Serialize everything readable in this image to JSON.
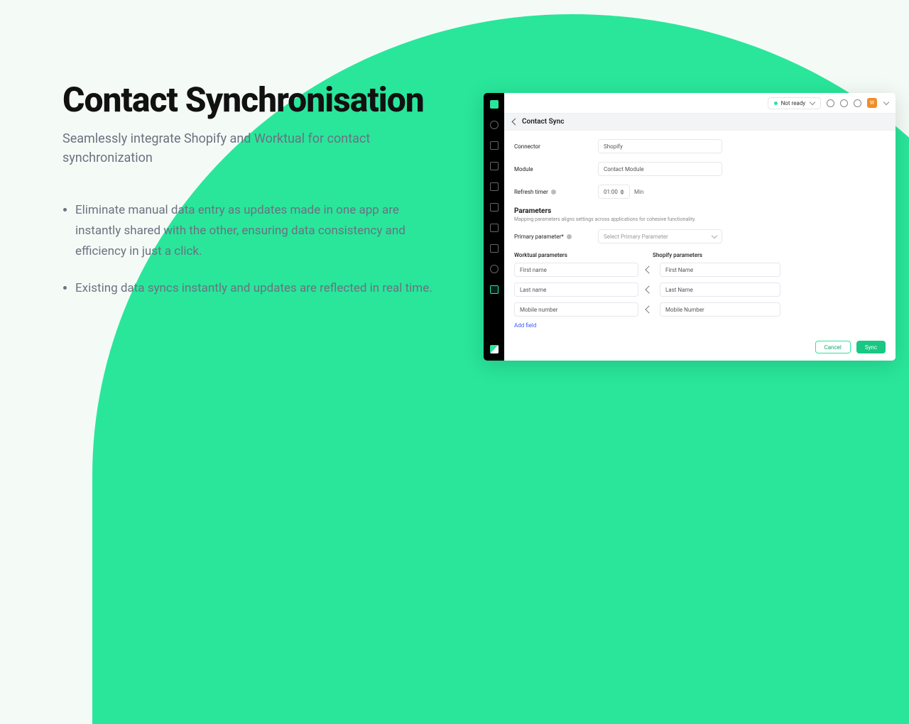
{
  "marketing": {
    "title": "Contact Synchronisation",
    "subtitle": "Seamlessly integrate Shopify and Worktual for contact synchronization",
    "bullets": [
      "Eliminate manual data entry as updates made in one app are instantly shared with the other, ensuring data consistency and efficiency in just a click.",
      "Existing data syncs instantly and updates are reflected in real time."
    ]
  },
  "topbar": {
    "status": "Not ready",
    "avatar": "W"
  },
  "crumb": {
    "title": "Contact Sync"
  },
  "form": {
    "connector_label": "Connector",
    "connector_value": "Shopify",
    "module_label": "Module",
    "module_value": "Contact Module",
    "refresh_label": "Refresh timer",
    "refresh_value": "01:00",
    "refresh_unit": "Min",
    "params_title": "Parameters",
    "params_sub": "Mapping parameters aligns settings across applications for cohesive functionality.",
    "primary_label": "Primary parameter*",
    "primary_placeholder": "Select Primary Parameter",
    "col1": "Worktual parameters",
    "col2": "Shopify parameters",
    "rows": [
      {
        "w": "First name",
        "s": "First Name"
      },
      {
        "w": "Last name",
        "s": "Last Name"
      },
      {
        "w": "Mobile number",
        "s": "Mobile Number"
      }
    ],
    "add_field": "Add field"
  },
  "buttons": {
    "cancel": "Cancel",
    "sync": "Sync"
  }
}
